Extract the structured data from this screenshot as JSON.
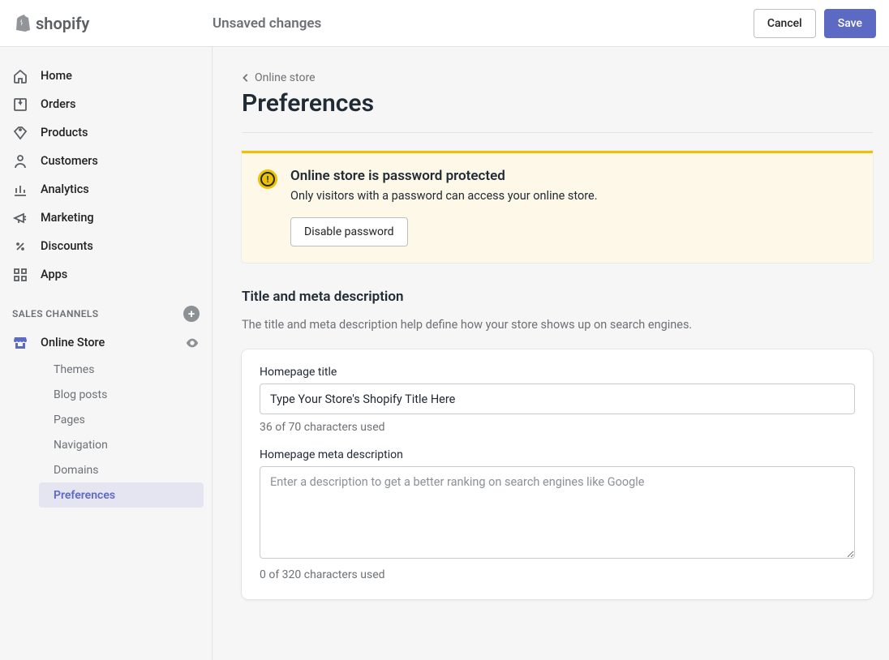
{
  "brand": "shopify",
  "topbar": {
    "title": "Unsaved changes",
    "cancel": "Cancel",
    "save": "Save"
  },
  "nav": {
    "items": [
      {
        "label": "Home"
      },
      {
        "label": "Orders"
      },
      {
        "label": "Products"
      },
      {
        "label": "Customers"
      },
      {
        "label": "Analytics"
      },
      {
        "label": "Marketing"
      },
      {
        "label": "Discounts"
      },
      {
        "label": "Apps"
      }
    ],
    "section_title": "SALES CHANNELS",
    "channel": "Online Store",
    "sub": [
      {
        "label": "Themes"
      },
      {
        "label": "Blog posts"
      },
      {
        "label": "Pages"
      },
      {
        "label": "Navigation"
      },
      {
        "label": "Domains"
      },
      {
        "label": "Preferences"
      }
    ]
  },
  "breadcrumb": "Online store",
  "page_title": "Preferences",
  "banner": {
    "title": "Online store is password protected",
    "text": "Only visitors with a password can access your online store.",
    "action": "Disable password"
  },
  "meta_section": {
    "heading": "Title and meta description",
    "desc": "The title and meta description help define how your store shows up on search engines.",
    "title_label": "Homepage title",
    "title_value": "Type Your Store's Shopify Title Here",
    "title_hint": "36 of 70 characters used",
    "desc_label": "Homepage meta description",
    "desc_placeholder": "Enter a description to get a better ranking on search engines like Google",
    "desc_hint": "0 of 320 characters used"
  }
}
